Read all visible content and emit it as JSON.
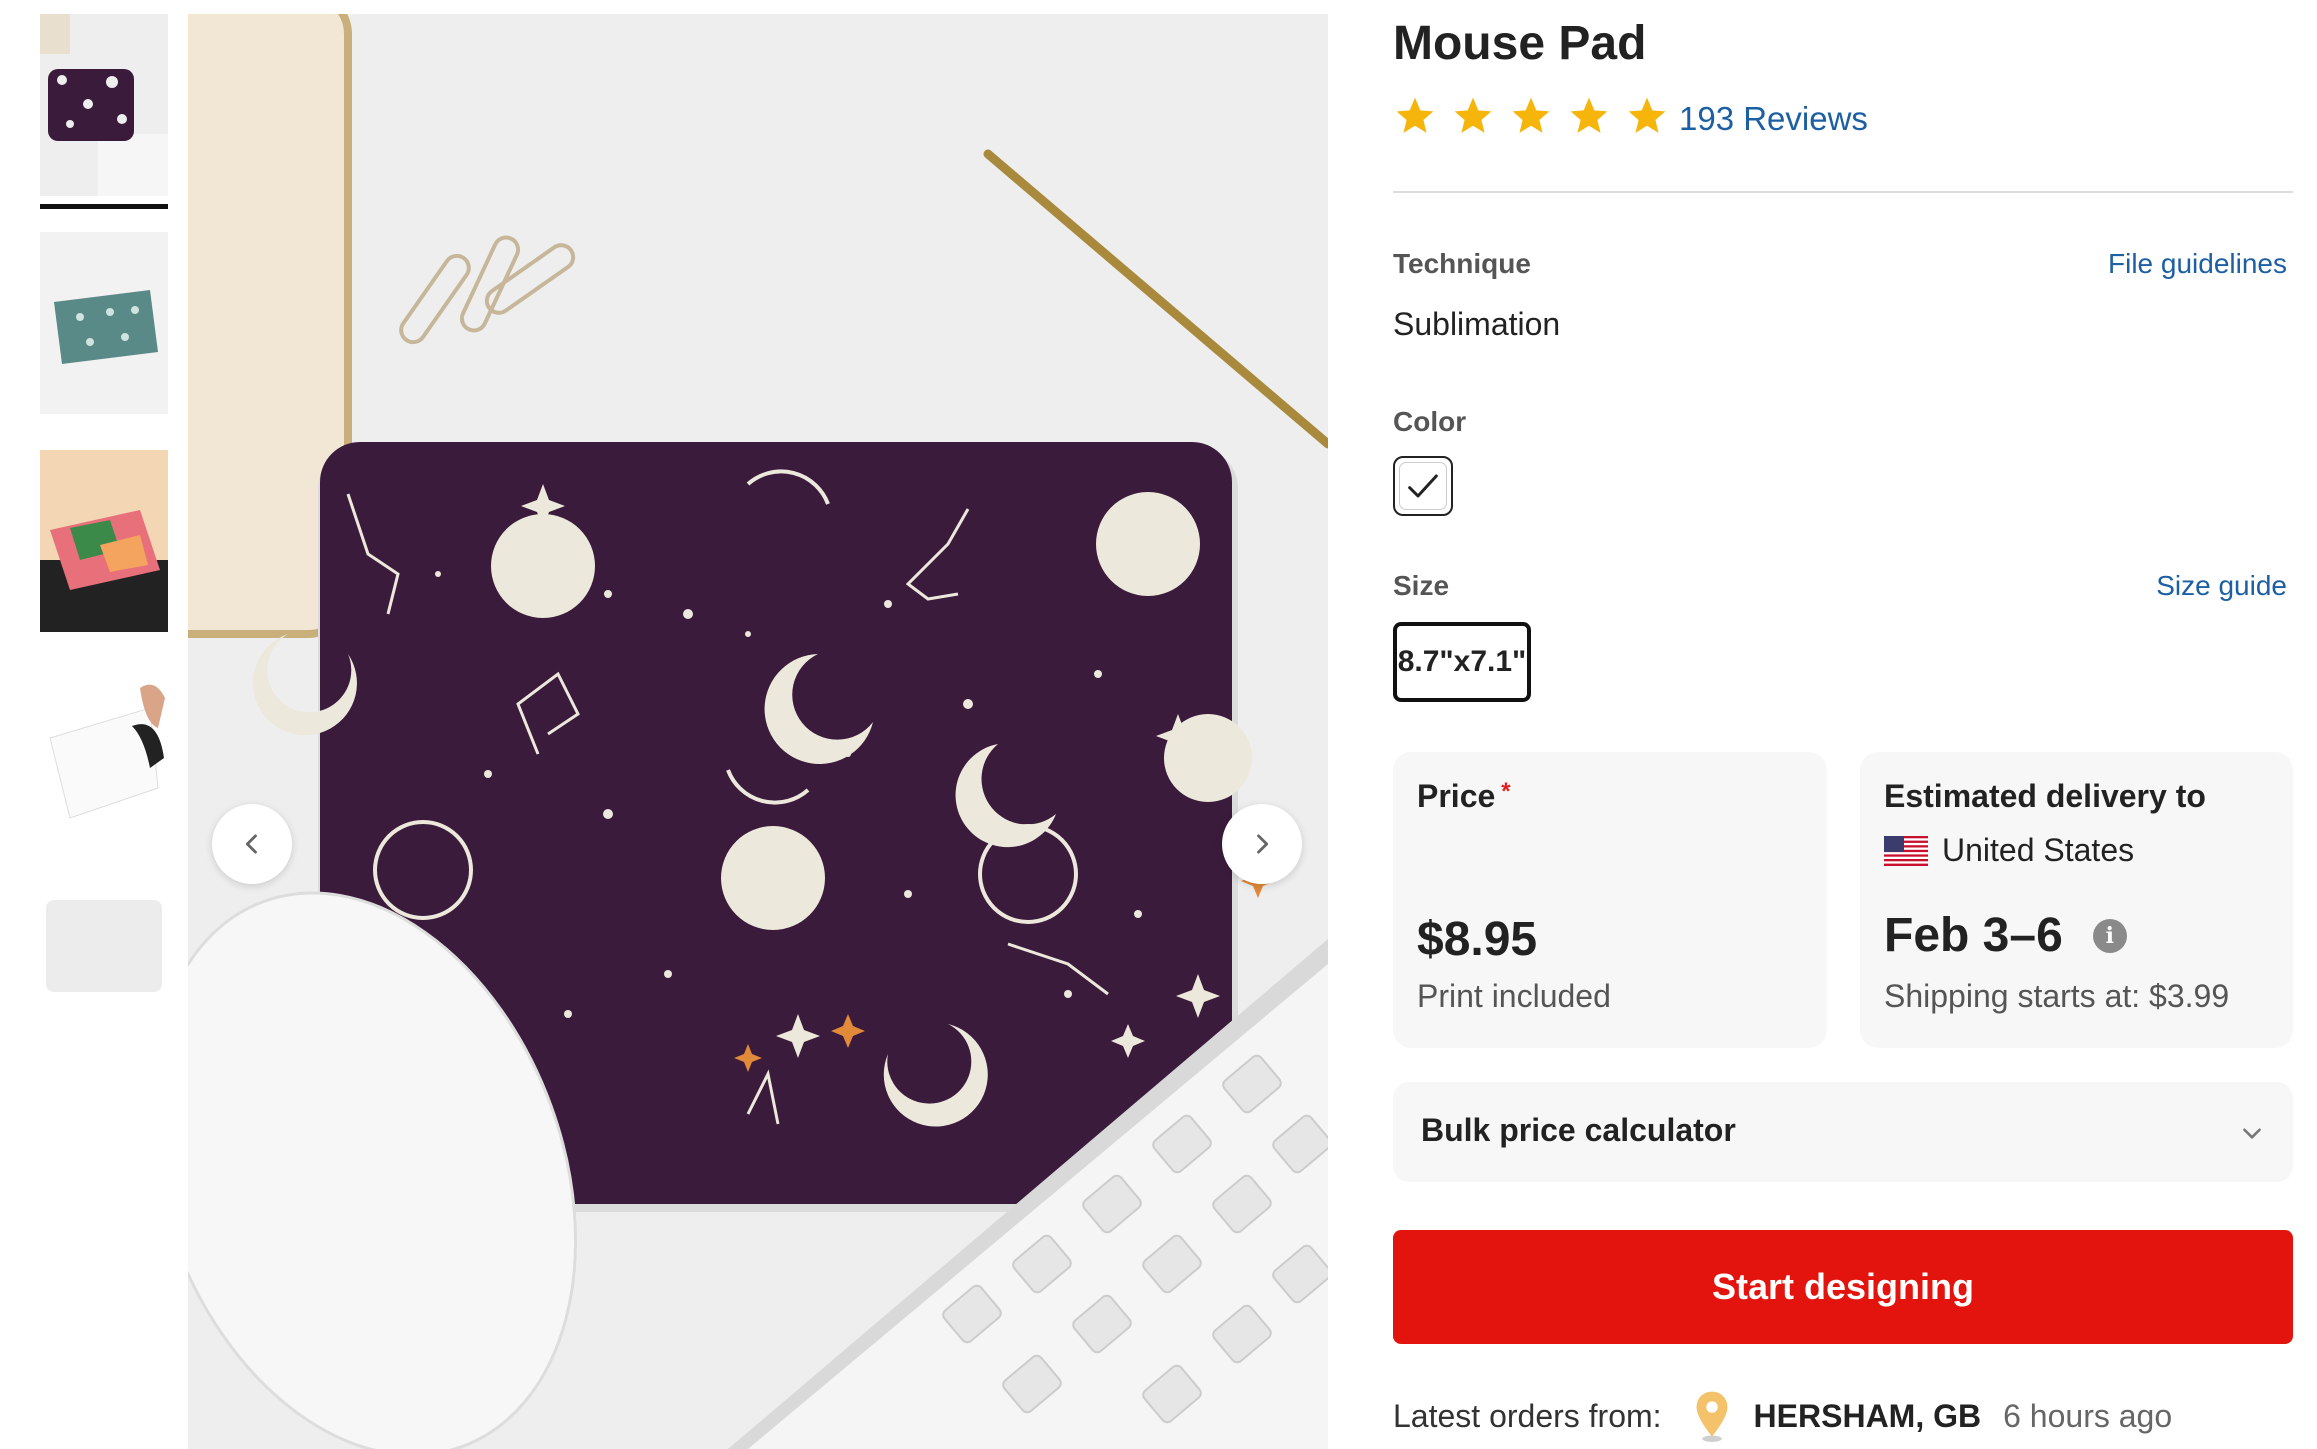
{
  "product": {
    "title": "Mouse Pad",
    "rating_stars": 5,
    "reviews_label": "193 Reviews"
  },
  "technique": {
    "label": "Technique",
    "value": "Sublimation",
    "guidelines_link": "File guidelines"
  },
  "color": {
    "label": "Color",
    "selected": "white"
  },
  "size": {
    "label": "Size",
    "guide_link": "Size guide",
    "selected": "8.7\"x7.1\""
  },
  "price": {
    "label": "Price",
    "required_mark": "*",
    "value": "$8.95",
    "note": "Print included"
  },
  "delivery": {
    "label": "Estimated delivery to",
    "country": "United States",
    "dates": "Feb 3–6",
    "info_icon": "i",
    "shipping": "Shipping starts at: $3.99"
  },
  "bulk": {
    "label": "Bulk price calculator"
  },
  "cta": {
    "label": "Start designing"
  },
  "orders": {
    "label": "Latest orders from:",
    "location": "HERSHAM, GB",
    "time": "6 hours ago"
  },
  "gallery": {
    "thumbnails": [
      "purple-celestial-pad",
      "teal-pattern-pad",
      "floral-pad",
      "hand-peeling-pad",
      "blank-pad"
    ],
    "active_index": 0
  },
  "colors": {
    "accent_red": "#e3140e",
    "link_blue": "#1d5fa3",
    "star_yellow": "#f5b50a",
    "pad_purple": "#3a1b3b"
  }
}
